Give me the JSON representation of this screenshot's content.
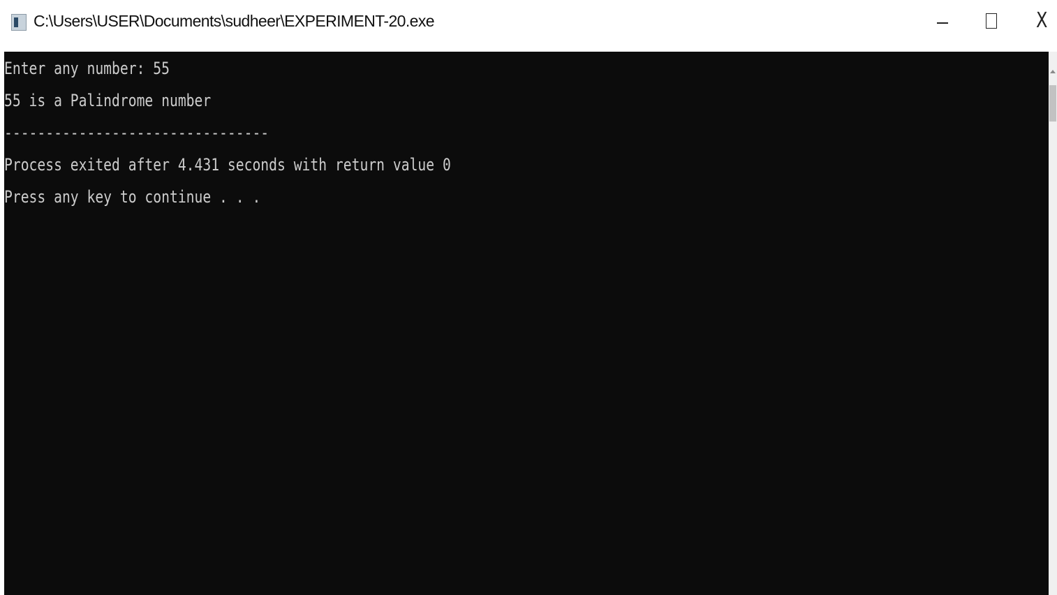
{
  "window": {
    "title": "C:\\Users\\USER\\Documents\\sudheer\\EXPERIMENT-20.exe",
    "icon": "console-app-icon",
    "controls": {
      "minimize_icon": "minimize-icon",
      "maximize_icon": "maximize-icon",
      "close_label": "X"
    }
  },
  "console": {
    "lines": [
      "Enter any number: 55",
      "55 is a Palindrome number",
      "--------------------------------",
      "Process exited after 4.431 seconds with return value 0",
      "Press any key to continue . . ."
    ]
  },
  "colors": {
    "console_background": "#0c0c0c",
    "console_text": "#cccccc",
    "titlebar": "#ffffff"
  }
}
